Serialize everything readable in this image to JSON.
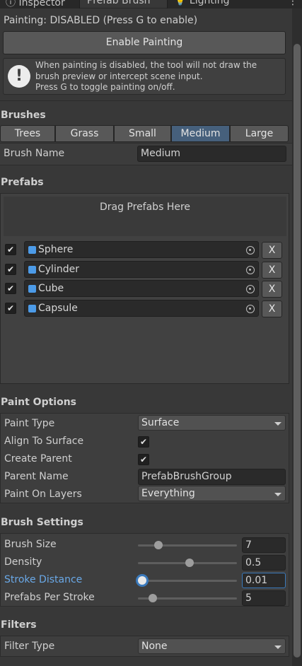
{
  "tabs": [
    {
      "label": "Inspector",
      "icon": "info-icon",
      "active": false
    },
    {
      "label": "Prefab Brush",
      "icon": "",
      "active": true
    },
    {
      "label": "Lighting",
      "icon": "bulb-icon",
      "active": false
    }
  ],
  "status": {
    "painting_text": "Painting: DISABLED (Press G to enable)"
  },
  "enable_button": {
    "label": "Enable Painting"
  },
  "help": {
    "icon": "warning-icon",
    "line1": "When painting is disabled, the tool will not draw the",
    "line2": "brush preview or intercept scene input.",
    "line3": "Press G to toggle painting on/off."
  },
  "brushes": {
    "header": "Brushes",
    "tabs": [
      "Trees",
      "Grass",
      "Small",
      "Medium",
      "Large"
    ],
    "selected": "Medium",
    "name_label": "Brush Name",
    "name_value": "Medium"
  },
  "prefabs": {
    "header": "Prefabs",
    "drop_text": "Drag Prefabs Here",
    "items": [
      {
        "name": "Sphere",
        "enabled": true,
        "remove": "X"
      },
      {
        "name": "Cylinder",
        "enabled": true,
        "remove": "X"
      },
      {
        "name": "Cube",
        "enabled": true,
        "remove": "X"
      },
      {
        "name": "Capsule",
        "enabled": true,
        "remove": "X"
      }
    ]
  },
  "paint_options": {
    "header": "Paint Options",
    "paint_type_label": "Paint Type",
    "paint_type_value": "Surface",
    "align_label": "Align To Surface",
    "align_checked": true,
    "create_parent_label": "Create Parent",
    "create_parent_checked": true,
    "parent_name_label": "Parent Name",
    "parent_name_value": "PrefabBrushGroup",
    "layers_label": "Paint On Layers",
    "layers_value": "Everything"
  },
  "brush_settings": {
    "header": "Brush Settings",
    "rows": [
      {
        "label": "Brush Size",
        "value": "7",
        "fraction": 0.17,
        "active": false
      },
      {
        "label": "Density",
        "value": "0.5",
        "fraction": 0.5,
        "active": false
      },
      {
        "label": "Stroke Distance",
        "value": "0.01",
        "fraction": 0.0,
        "active": true
      },
      {
        "label": "Prefabs Per Stroke",
        "value": "5",
        "fraction": 0.11,
        "active": false
      }
    ]
  },
  "filters": {
    "header": "Filters",
    "type_label": "Filter Type",
    "type_value": "None"
  },
  "colors": {
    "background": "#383838",
    "accent": "#46607c",
    "active_label": "#6aa9e8",
    "prefab_icon": "#4c9be8"
  }
}
